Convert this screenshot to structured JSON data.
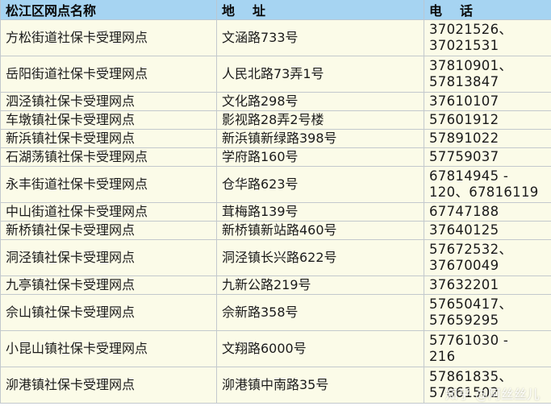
{
  "header": {
    "name": "松江区网点名称",
    "address": "地址",
    "phone": "电话"
  },
  "rows": [
    {
      "name": "方松街道社保卡受理网点",
      "address": "文涵路733号",
      "phone": [
        "37021526、",
        "37021531"
      ]
    },
    {
      "name": "岳阳街道社保卡受理网点",
      "address": "人民北路73弄1号",
      "phone": [
        "37810901、",
        "57813847"
      ]
    },
    {
      "name": "泗泾镇社保卡受理网点",
      "address": "文化路298号",
      "phone": [
        "37610107"
      ]
    },
    {
      "name": "车墩镇社保卡受理网点",
      "address": "影视路28弄2号楼",
      "phone": [
        "57601912"
      ]
    },
    {
      "name": "新浜镇社保卡受理网点",
      "address": "新浜镇新绿路398号",
      "phone": [
        "57891022"
      ]
    },
    {
      "name": "石湖荡镇社保卡受理网点",
      "address": "学府路160号",
      "phone": [
        "57759037"
      ]
    },
    {
      "name": "永丰街道社保卡受理网点",
      "address": "仓华路623号",
      "phone": [
        "67814945 -",
        "120、67816119"
      ]
    },
    {
      "name": "中山街道社保卡受理网点",
      "address": "茸梅路139号",
      "phone": [
        "67747188"
      ]
    },
    {
      "name": "新桥镇社保卡受理网点",
      "address": "新桥镇新站路460号",
      "phone": [
        "37640125"
      ]
    },
    {
      "name": "洞泾镇社保卡受理网点",
      "address": "洞泾镇长兴路622号",
      "phone": [
        "57672532、",
        "37670049"
      ]
    },
    {
      "name": "九亭镇社保卡受理网点",
      "address": "九新公路219号",
      "phone": [
        "37632201"
      ]
    },
    {
      "name": "佘山镇社保卡受理网点",
      "address": "佘新路358号",
      "phone": [
        "57650417、",
        "57659295"
      ]
    },
    {
      "name": "小昆山镇社保卡受理网点",
      "address": "文翔路6000号",
      "phone": [
        "57761030 -",
        "216"
      ]
    },
    {
      "name": "泖港镇社保卡受理网点",
      "address": "泖港镇中南路35号",
      "phone": [
        "57861835、",
        "57861502"
      ]
    }
  ],
  "watermark": "知乎 @阿丝丝儿"
}
